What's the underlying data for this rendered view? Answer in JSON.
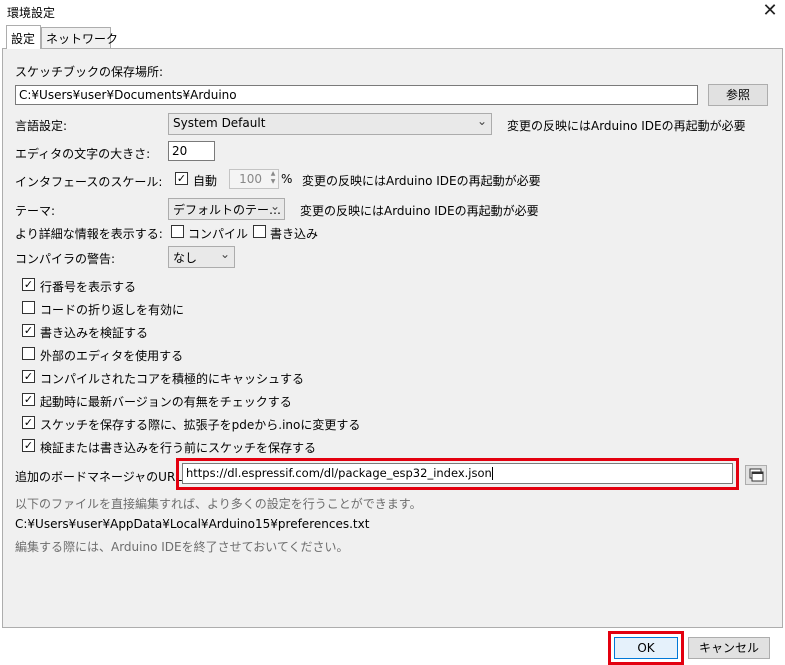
{
  "window": {
    "title": "環境設定",
    "close_glyph": "✕"
  },
  "tabs": [
    {
      "label": "設定"
    },
    {
      "label": "ネットワーク"
    }
  ],
  "sketchbook": {
    "label": "スケッチブックの保存場所:",
    "path": "C:¥Users¥user¥Documents¥Arduino",
    "browse_label": "参照"
  },
  "language": {
    "label": "言語設定:",
    "value": "System Default",
    "note": "変更の反映にはArduino IDEの再起動が必要"
  },
  "font_size": {
    "label": "エディタの文字の大きさ:",
    "value": "20"
  },
  "scale": {
    "label": "インタフェースのスケール:",
    "auto_label": "自動",
    "auto_checked": true,
    "value": "100",
    "unit": "%",
    "note": "変更の反映にはArduino IDEの再起動が必要"
  },
  "theme": {
    "label": "テーマ:",
    "value": "デフォルトのテー…",
    "note": "変更の反映にはArduino IDEの再起動が必要"
  },
  "verbose": {
    "label": "より詳細な情報を表示する:",
    "compile_label": "コンパイル",
    "compile_checked": false,
    "upload_label": "書き込み",
    "upload_checked": false
  },
  "warnings": {
    "label": "コンパイラの警告:",
    "value": "なし"
  },
  "options": [
    {
      "label": "行番号を表示する",
      "checked": true
    },
    {
      "label": "コードの折り返しを有効に",
      "checked": false
    },
    {
      "label": "書き込みを検証する",
      "checked": true
    },
    {
      "label": "外部のエディタを使用する",
      "checked": false
    },
    {
      "label": "コンパイルされたコアを積極的にキャッシュする",
      "checked": true
    },
    {
      "label": "起動時に最新バージョンの有無をチェックする",
      "checked": true
    },
    {
      "label": "スケッチを保存する際に、拡張子をpdeから.inoに変更する",
      "checked": true
    },
    {
      "label": "検証または書き込みを行う前にスケッチを保存する",
      "checked": true
    }
  ],
  "board_manager": {
    "label": "追加のボードマネージャのURL:",
    "url": "https://dl.espressif.com/dl/package_esp32_index.json"
  },
  "info": {
    "line1": "以下のファイルを直接編集すれば、より多くの設定を行うことができます。",
    "path": "C:¥Users¥user¥AppData¥Local¥Arduino15¥preferences.txt",
    "line2": "編集する際には、Arduino IDEを終了させておいてください。"
  },
  "footer": {
    "ok_label": "OK",
    "cancel_label": "キャンセル"
  },
  "colors": {
    "highlight": "#e3000f",
    "panel": "#f0f0f0",
    "hint": "#6d6d6d"
  },
  "check_glyph": "✓",
  "chevron_glyph": "⌄"
}
